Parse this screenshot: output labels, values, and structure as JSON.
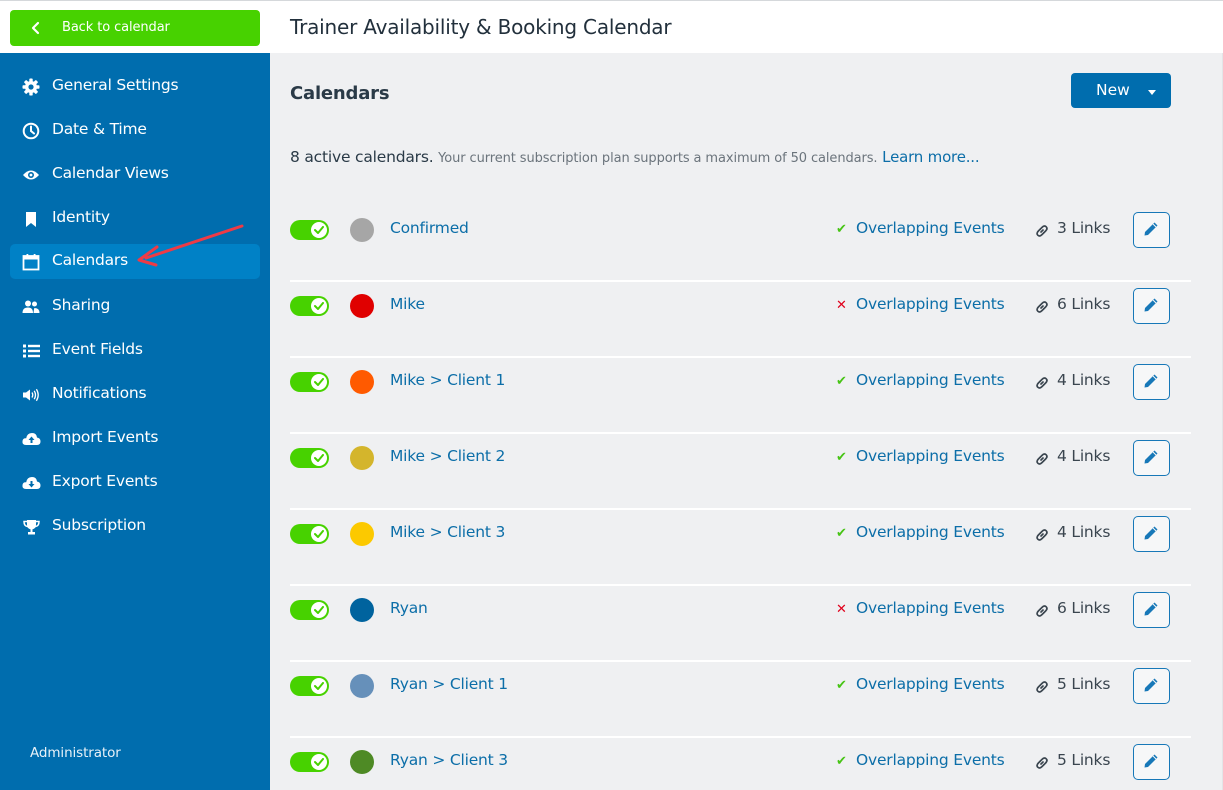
{
  "header": {
    "title": "Trainer Availability & Booking Calendar"
  },
  "sidebar": {
    "back_label": "Back to calendar",
    "items": [
      {
        "label": "General Settings",
        "icon": "gear-icon",
        "active": false
      },
      {
        "label": "Date & Time",
        "icon": "clock-icon",
        "active": false
      },
      {
        "label": "Calendar Views",
        "icon": "eye-icon",
        "active": false
      },
      {
        "label": "Identity",
        "icon": "bookmark-icon",
        "active": false
      },
      {
        "label": "Calendars",
        "icon": "calendar-icon",
        "active": true
      },
      {
        "label": "Sharing",
        "icon": "users-icon",
        "active": false
      },
      {
        "label": "Event Fields",
        "icon": "list-icon",
        "active": false
      },
      {
        "label": "Notifications",
        "icon": "speaker-icon",
        "active": false
      },
      {
        "label": "Import Events",
        "icon": "cloud-upload-icon",
        "active": false
      },
      {
        "label": "Export Events",
        "icon": "cloud-download-icon",
        "active": false
      },
      {
        "label": "Subscription",
        "icon": "trophy-icon",
        "active": false
      }
    ],
    "footer_label": "Administrator"
  },
  "main": {
    "section_title": "Calendars",
    "new_button_label": "New",
    "summary": {
      "count_text": "8 active calendars.",
      "plan_text": "Your current subscription plan supports a maximum of 50 calendars.",
      "learn_more_label": "Learn more..."
    },
    "calendars": [
      {
        "name": "Confirmed",
        "color": "#a6a6a6",
        "enabled": true,
        "overlapping_allowed": true,
        "overlap_label": "Overlapping Events",
        "links_label": "3 Links"
      },
      {
        "name": "Mike",
        "color": "#e00000",
        "enabled": true,
        "overlapping_allowed": false,
        "overlap_label": "Overlapping Events",
        "links_label": "6 Links"
      },
      {
        "name": "Mike > Client 1",
        "color": "#ff5a00",
        "enabled": true,
        "overlapping_allowed": true,
        "overlap_label": "Overlapping Events",
        "links_label": "4 Links"
      },
      {
        "name": "Mike > Client 2",
        "color": "#d4b52c",
        "enabled": true,
        "overlapping_allowed": true,
        "overlap_label": "Overlapping Events",
        "links_label": "4 Links"
      },
      {
        "name": "Mike > Client 3",
        "color": "#fcc900",
        "enabled": true,
        "overlapping_allowed": true,
        "overlap_label": "Overlapping Events",
        "links_label": "4 Links"
      },
      {
        "name": "Ryan",
        "color": "#00639e",
        "enabled": true,
        "overlapping_allowed": false,
        "overlap_label": "Overlapping Events",
        "links_label": "6 Links"
      },
      {
        "name": "Ryan > Client 1",
        "color": "#6690ba",
        "enabled": true,
        "overlapping_allowed": true,
        "overlap_label": "Overlapping Events",
        "links_label": "5 Links"
      },
      {
        "name": "Ryan > Client 3",
        "color": "#4e8a25",
        "enabled": true,
        "overlapping_allowed": true,
        "overlap_label": "Overlapping Events",
        "links_label": "5 Links"
      }
    ]
  },
  "colors": {
    "sidebar_bg": "#006dae",
    "sidebar_active": "#0081c6",
    "back_button": "#47d200",
    "accent": "#0c6ea8",
    "toggle_on": "#47d200",
    "check": "#47c415",
    "cross": "#e0001b",
    "annotation_arrow": "#ef3a45"
  }
}
